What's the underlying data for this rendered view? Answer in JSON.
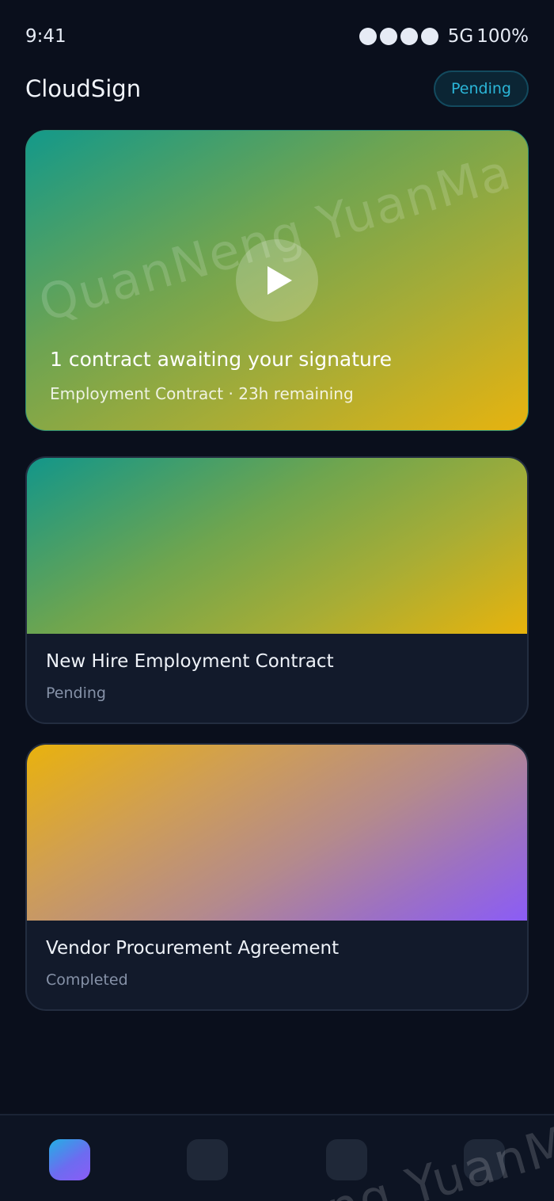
{
  "status_bar": {
    "time": "9:41",
    "network": "5G",
    "battery": "100%"
  },
  "header": {
    "title": "CloudSign",
    "status_pill": "Pending"
  },
  "hero": {
    "title": "1 contract awaiting your signature",
    "subtitle": "Employment Contract · 23h remaining",
    "watermark": "QuanNeng YuanMa · in"
  },
  "contracts": [
    {
      "title": "New Hire Employment Contract",
      "status": "Pending"
    },
    {
      "title": "Vendor Procurement Agreement",
      "status": "Completed"
    }
  ],
  "bottom_nav": {
    "watermark": "Neng YuanMa"
  },
  "colors": {
    "accent": "#2bb6d8",
    "background": "#0a0f1c",
    "card": "#121a2b",
    "purple": "#8b5cf6",
    "amber": "#e7b30f"
  }
}
